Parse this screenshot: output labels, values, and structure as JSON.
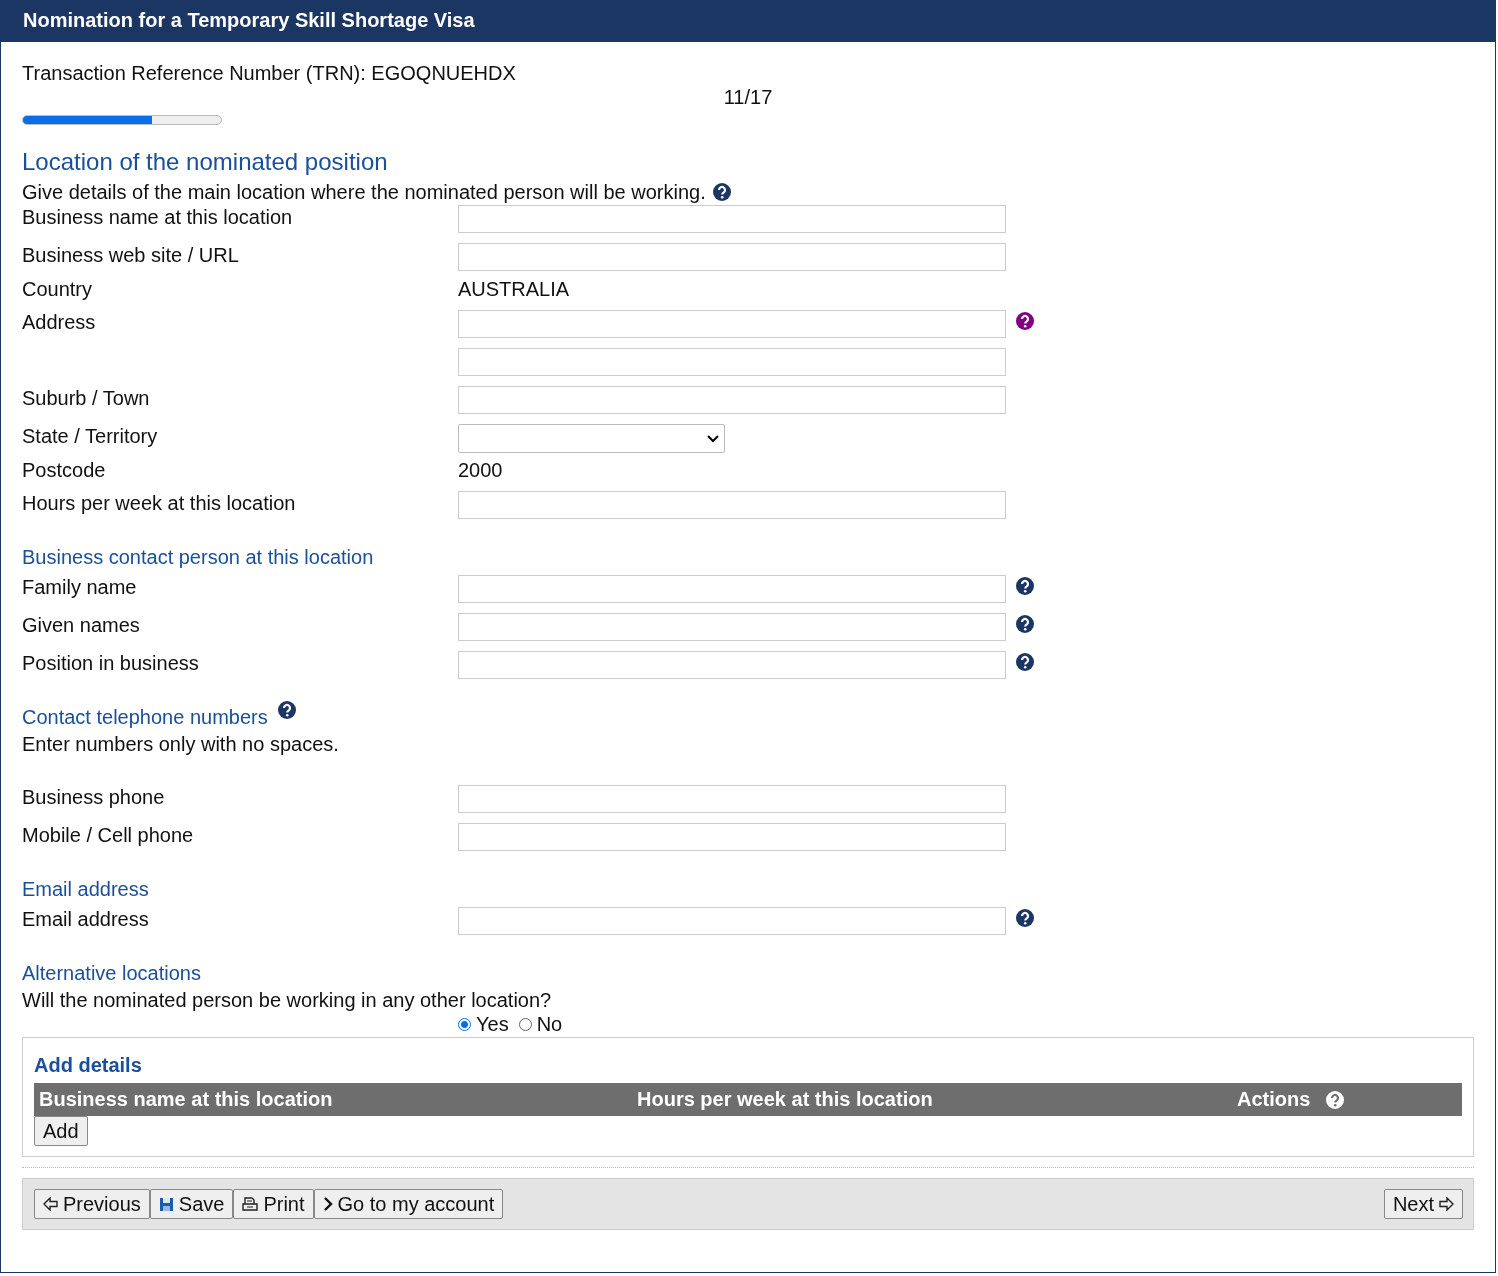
{
  "window": {
    "title": "Nomination for a Temporary Skill Shortage Visa"
  },
  "trn": "Transaction Reference Number (TRN): EGOQNUEHDX",
  "progress": {
    "step": "11/17",
    "level": 0.65
  },
  "form": [
    {
      "kind": "title",
      "text": "Location of the nominated position"
    },
    {
      "kind": "note",
      "text": "Give details of the main location where the nominated person will be working.",
      "help_icon": {
        "color": "#1c3664"
      }
    },
    {
      "kind": "field",
      "label": "Business name at this location"
    },
    {
      "kind": "field",
      "label": "Business web site / URL"
    },
    {
      "kind": "static",
      "label": "Country",
      "value": "AUSTRALIA"
    },
    {
      "kind": "field",
      "label": "Address",
      "help_icon": {
        "color": "#800080"
      }
    },
    {
      "kind": "field"
    },
    {
      "kind": "field",
      "label": "Suburb / Town"
    },
    {
      "kind": "select",
      "label": "State / Territory"
    },
    {
      "kind": "static",
      "label": "Postcode",
      "value": "2000"
    },
    {
      "kind": "field",
      "label": "Hours per week at this location"
    },
    {
      "kind": "heading",
      "text": "Business contact person at this location"
    },
    {
      "kind": "field",
      "label": "Family name",
      "help_icon": {
        "color": "#1c3664"
      }
    },
    {
      "kind": "field",
      "label": "Given names",
      "help_icon": {
        "color": "#1c3664"
      }
    },
    {
      "kind": "field",
      "label": "Position in business",
      "help_icon": {
        "color": "#1c3664"
      }
    },
    {
      "kind": "heading",
      "text": "Contact telephone numbers",
      "help_icon": {
        "color": "#1c3664"
      }
    },
    {
      "kind": "note",
      "text": "Enter numbers only with no spaces."
    },
    {
      "kind": "field",
      "label": "Business phone"
    },
    {
      "kind": "field",
      "label": "Mobile / Cell phone"
    },
    {
      "kind": "heading",
      "text": "Email address"
    },
    {
      "kind": "field",
      "label": "Email address",
      "help_icon": {
        "color": "#1c3664"
      }
    },
    {
      "kind": "heading",
      "text": "Alternative locations"
    },
    {
      "kind": "note",
      "text": "Will the nominated person be working in any other location?"
    },
    {
      "kind": "radio",
      "options": [
        {
          "label": "Yes",
          "selected": true
        },
        {
          "label": "No",
          "selected": false
        }
      ]
    }
  ],
  "details": {
    "title": "Add details",
    "columns": [
      "Business name at this location",
      "Hours per week at this location",
      "Actions"
    ],
    "add_button": "Add"
  },
  "footer": {
    "buttons": [
      {
        "kind": "previous",
        "label": "Previous"
      },
      {
        "kind": "save",
        "label": "Save"
      },
      {
        "kind": "print",
        "label": "Print"
      },
      {
        "kind": "account",
        "label": "Go to my account"
      }
    ],
    "next": "Next"
  }
}
